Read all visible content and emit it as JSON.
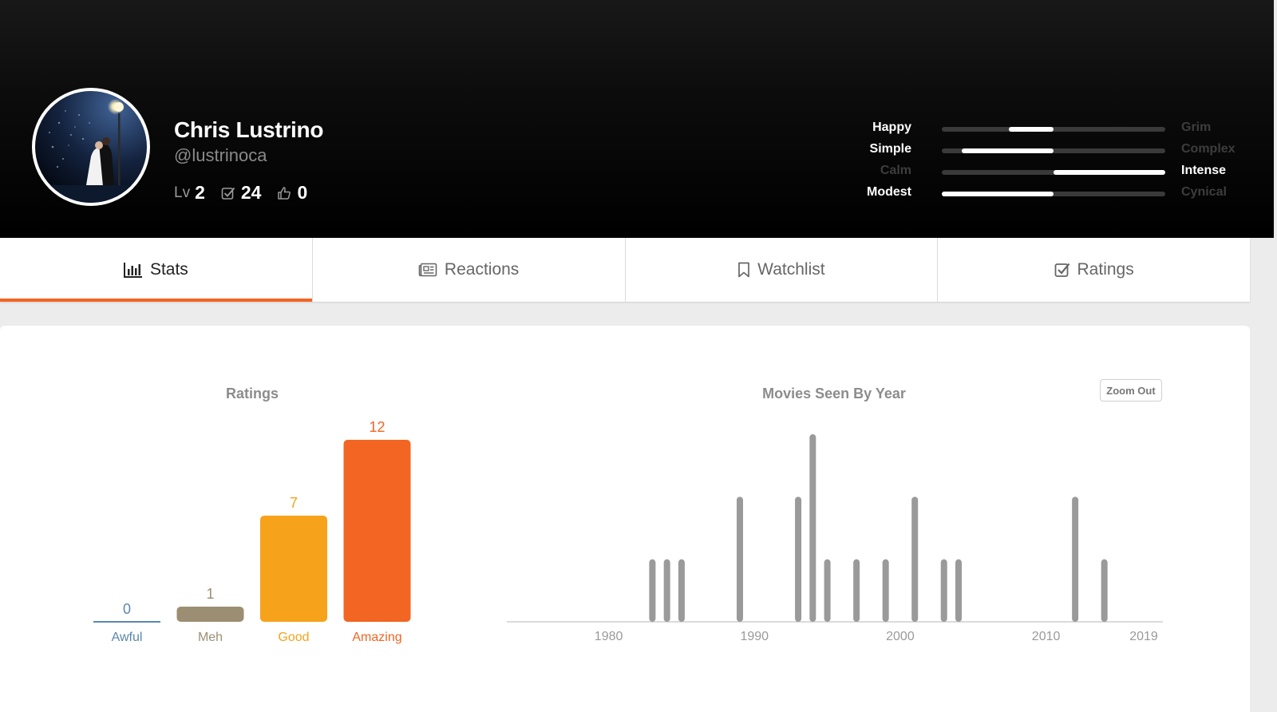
{
  "profile": {
    "name": "Chris Lustrino",
    "handle": "@lustrinoca",
    "level_label": "Lv",
    "level": "2",
    "ratings_count": "24",
    "likes_count": "0"
  },
  "moods": [
    {
      "left": "Happy",
      "right": "Grim",
      "from": 0.3,
      "to": 0.5,
      "active": "left"
    },
    {
      "left": "Simple",
      "right": "Complex",
      "from": 0.09,
      "to": 0.5,
      "active": "left"
    },
    {
      "left": "Calm",
      "right": "Intense",
      "from": 0.5,
      "to": 1.0,
      "active": "right"
    },
    {
      "left": "Modest",
      "right": "Cynical",
      "from": 0.0,
      "to": 0.5,
      "active": "left"
    }
  ],
  "tabs": [
    {
      "label": "Stats",
      "icon": "bar-chart-icon",
      "active": true
    },
    {
      "label": "Reactions",
      "icon": "newspaper-icon",
      "active": false
    },
    {
      "label": "Watchlist",
      "icon": "bookmark-icon",
      "active": false
    },
    {
      "label": "Ratings",
      "icon": "checkbox-icon",
      "active": false
    }
  ],
  "colors": {
    "accent": "#f26522",
    "awful": "#5b87ad",
    "meh": "#9c8e72",
    "good": "#f7a21b",
    "amazing": "#f26522",
    "year_bar": "#9a9a9a"
  },
  "zoom_out_label": "Zoom Out",
  "chart_data": [
    {
      "type": "bar",
      "title": "Ratings",
      "categories": [
        "Awful",
        "Meh",
        "Good",
        "Amazing"
      ],
      "values": [
        0,
        1,
        7,
        12
      ],
      "colors": [
        "#5b87ad",
        "#9c8e72",
        "#f7a21b",
        "#f26522"
      ]
    },
    {
      "type": "bar",
      "title": "Movies Seen By Year",
      "x_ticks": [
        "1980",
        "1990",
        "2000",
        "2010",
        "2019"
      ],
      "xlim": [
        1974,
        2019
      ],
      "x": [
        1983,
        1984,
        1985,
        1989,
        1993,
        1994,
        1995,
        1997,
        1999,
        2001,
        2003,
        2004,
        2012,
        2014
      ],
      "values": [
        2,
        2,
        2,
        4,
        4,
        6,
        2,
        2,
        2,
        4,
        2,
        2,
        4,
        2
      ],
      "ylim": [
        0,
        6
      ]
    }
  ]
}
